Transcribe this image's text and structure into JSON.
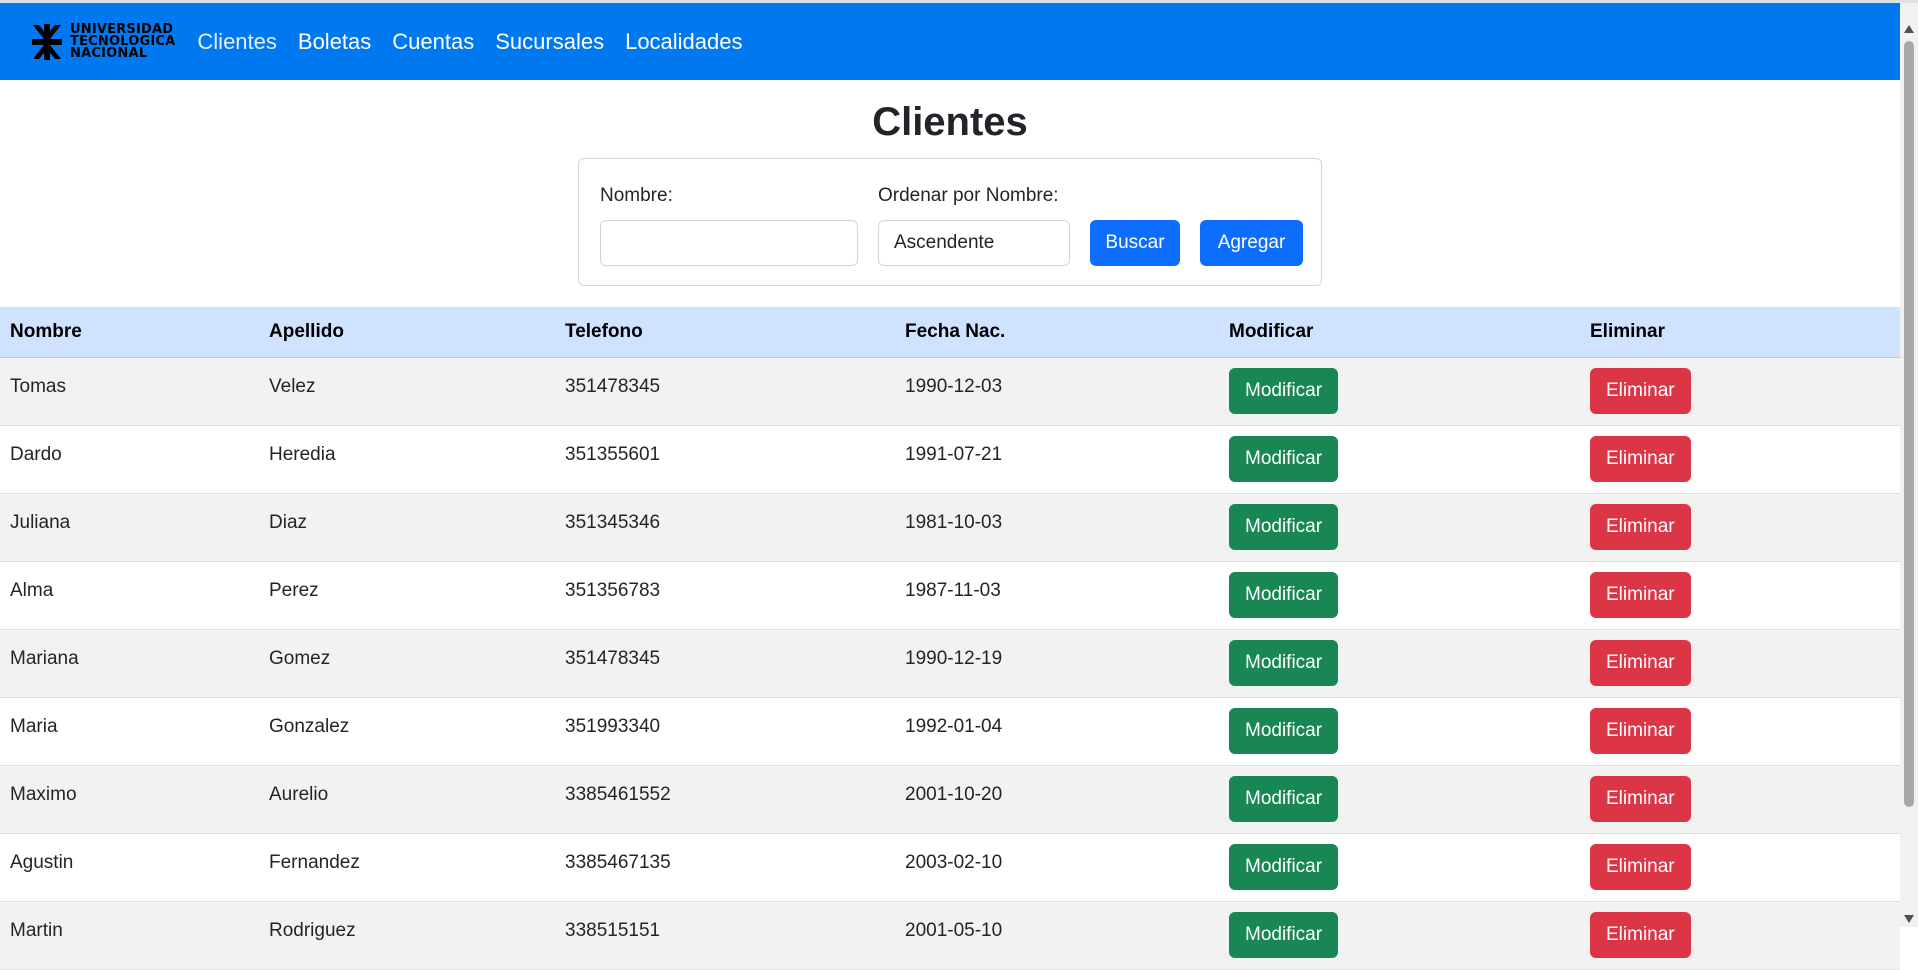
{
  "nav": {
    "brand_lines": [
      "UNIVERSIDAD",
      "TECNOLOGICA",
      "NACIONAL"
    ],
    "links": [
      "Clientes",
      "Boletas",
      "Cuentas",
      "Sucursales",
      "Localidades"
    ],
    "active": "Clientes",
    "color": "#0078f0"
  },
  "page": {
    "title": "Clientes"
  },
  "filter": {
    "nombre_label": "Nombre:",
    "nombre_value": "",
    "orden_label": "Ordenar por Nombre:",
    "orden_value": "Ascendente",
    "buscar_label": "Buscar",
    "agregar_label": "Agregar"
  },
  "table": {
    "headers": [
      "Nombre",
      "Apellido",
      "Telefono",
      "Fecha Nac.",
      "Modificar",
      "Eliminar"
    ],
    "modificar_label": "Modificar",
    "eliminar_label": "Eliminar",
    "rows": [
      {
        "nombre": "Tomas",
        "apellido": "Velez",
        "telefono": "351478345",
        "fecha": "1990-12-03"
      },
      {
        "nombre": "Dardo",
        "apellido": "Heredia",
        "telefono": "351355601",
        "fecha": "1991-07-21"
      },
      {
        "nombre": "Juliana",
        "apellido": "Diaz",
        "telefono": "351345346",
        "fecha": "1981-10-03"
      },
      {
        "nombre": "Alma",
        "apellido": "Perez",
        "telefono": "351356783",
        "fecha": "1987-11-03"
      },
      {
        "nombre": "Mariana",
        "apellido": "Gomez",
        "telefono": "351478345",
        "fecha": "1990-12-19"
      },
      {
        "nombre": "Maria",
        "apellido": "Gonzalez",
        "telefono": "351993340",
        "fecha": "1992-01-04"
      },
      {
        "nombre": "Maximo",
        "apellido": "Aurelio",
        "telefono": "3385461552",
        "fecha": "2001-10-20"
      },
      {
        "nombre": "Agustin",
        "apellido": "Fernandez",
        "telefono": "3385467135",
        "fecha": "2003-02-10"
      },
      {
        "nombre": "Martin",
        "apellido": "Rodriguez",
        "telefono": "338515151",
        "fecha": "2001-05-10"
      }
    ]
  },
  "colors": {
    "primary": "#0d6efd",
    "success": "#198754",
    "danger": "#dc3545",
    "header_bg": "#cfe2ff"
  }
}
